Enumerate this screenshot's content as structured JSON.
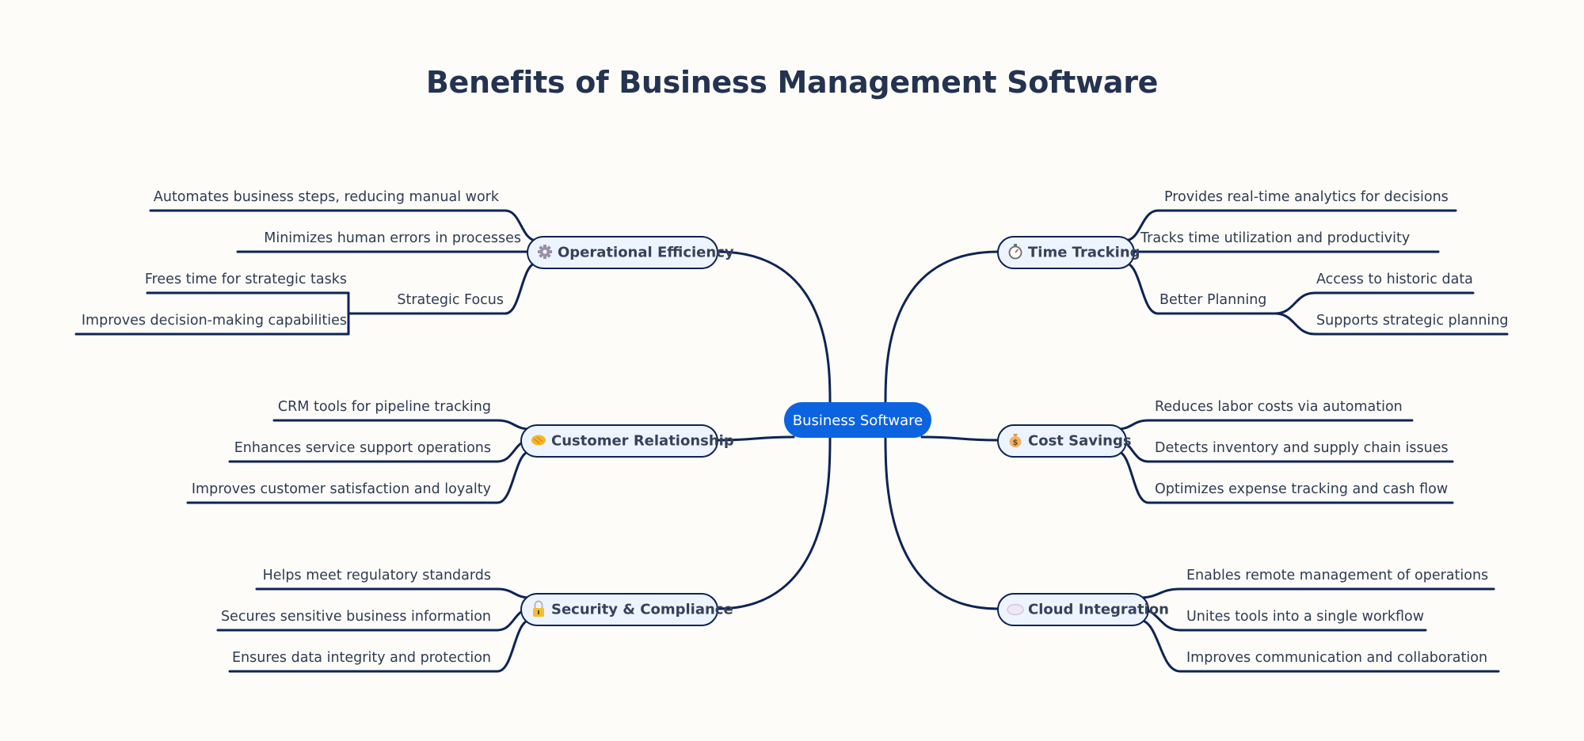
{
  "title": "Benefits of Business Management Software",
  "colors": {
    "background": "#fdfcf9",
    "root_fill": "#0c63e0",
    "branch_fill": "#eef4ff",
    "edge": "#0d2455",
    "text": "#2f3b52",
    "title": "#233350"
  },
  "root": {
    "label": "Business Software"
  },
  "branches": [
    {
      "label": "Operational Efficiency",
      "icon": "gear-icon",
      "side": "left",
      "children": [
        {
          "label": "Automates business steps, reducing manual work"
        },
        {
          "label": "Minimizes human errors in processes"
        },
        {
          "label": "Strategic Focus",
          "children": [
            {
              "label": "Frees time for strategic tasks"
            },
            {
              "label": "Improves decision-making capabilities"
            }
          ]
        }
      ]
    },
    {
      "label": "Customer Relationship",
      "icon": "handshake-icon",
      "side": "left",
      "children": [
        {
          "label": "CRM tools for pipeline tracking"
        },
        {
          "label": "Enhances service support operations"
        },
        {
          "label": "Improves customer satisfaction and loyalty"
        }
      ]
    },
    {
      "label": "Security & Compliance",
      "icon": "lock-icon",
      "side": "left",
      "children": [
        {
          "label": "Helps meet regulatory standards"
        },
        {
          "label": "Secures sensitive business information"
        },
        {
          "label": "Ensures data integrity and protection"
        }
      ]
    },
    {
      "label": "Time Tracking",
      "icon": "stopwatch-icon",
      "side": "right",
      "children": [
        {
          "label": "Provides real-time analytics for decisions"
        },
        {
          "label": "Tracks time utilization and productivity"
        },
        {
          "label": "Better Planning",
          "children": [
            {
              "label": "Access to historic data"
            },
            {
              "label": "Supports strategic planning"
            }
          ]
        }
      ]
    },
    {
      "label": "Cost Savings",
      "icon": "money-bag-icon",
      "side": "right",
      "children": [
        {
          "label": "Reduces labor costs via automation"
        },
        {
          "label": "Detects inventory and supply chain issues"
        },
        {
          "label": "Optimizes expense tracking and cash flow"
        }
      ]
    },
    {
      "label": "Cloud Integration",
      "icon": "cloud-icon",
      "side": "right",
      "children": [
        {
          "label": "Enables remote management of operations"
        },
        {
          "label": "Unites tools into a single workflow"
        },
        {
          "label": "Improves communication and collaboration"
        }
      ]
    }
  ]
}
